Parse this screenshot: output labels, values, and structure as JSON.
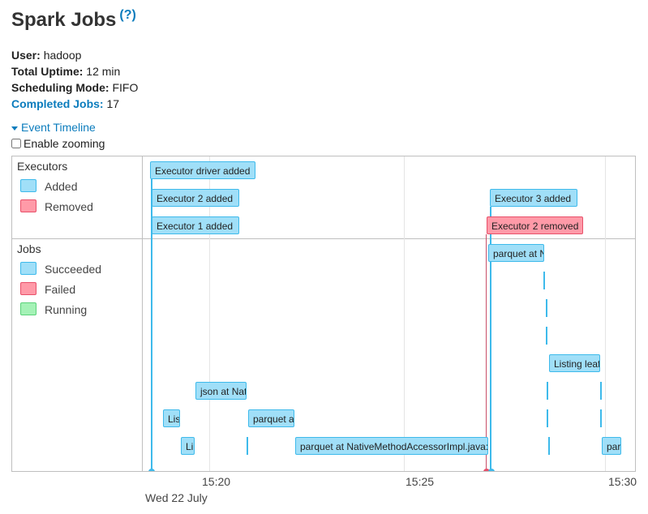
{
  "header": {
    "title": "Spark Jobs",
    "help": "(?)"
  },
  "summary": {
    "user_label": "User:",
    "user_value": "hadoop",
    "uptime_label": "Total Uptime:",
    "uptime_value": "12 min",
    "mode_label": "Scheduling Mode:",
    "mode_value": "FIFO",
    "completed_label": "Completed Jobs:",
    "completed_value": "17"
  },
  "timeline_toggle": "Event Timeline",
  "zoom_label": "Enable zooming",
  "groups": {
    "executors": {
      "title": "Executors",
      "legend": [
        "Added",
        "Removed"
      ]
    },
    "jobs": {
      "title": "Jobs",
      "legend": [
        "Succeeded",
        "Failed",
        "Running"
      ]
    }
  },
  "executor_events": [
    "Executor driver added",
    "Executor 2 added",
    "Executor 1 added",
    "Executor 3 added",
    "Executor 2 removed"
  ],
  "job_boxes": [
    "parquet at N",
    "Listing leaf",
    "json at Nat",
    "Lis",
    "parquet a",
    "Li",
    "parquet at NativeMethodAccessorImpl.java:",
    "par"
  ],
  "axis": {
    "ticks": [
      "15:20",
      "15:25",
      "15:30"
    ],
    "date": "Wed 22 July"
  },
  "colors": {
    "added": "#a0dff8",
    "removed": "#ff9aa8",
    "running": "#a4f2b6",
    "link": "#0b7cbd"
  }
}
